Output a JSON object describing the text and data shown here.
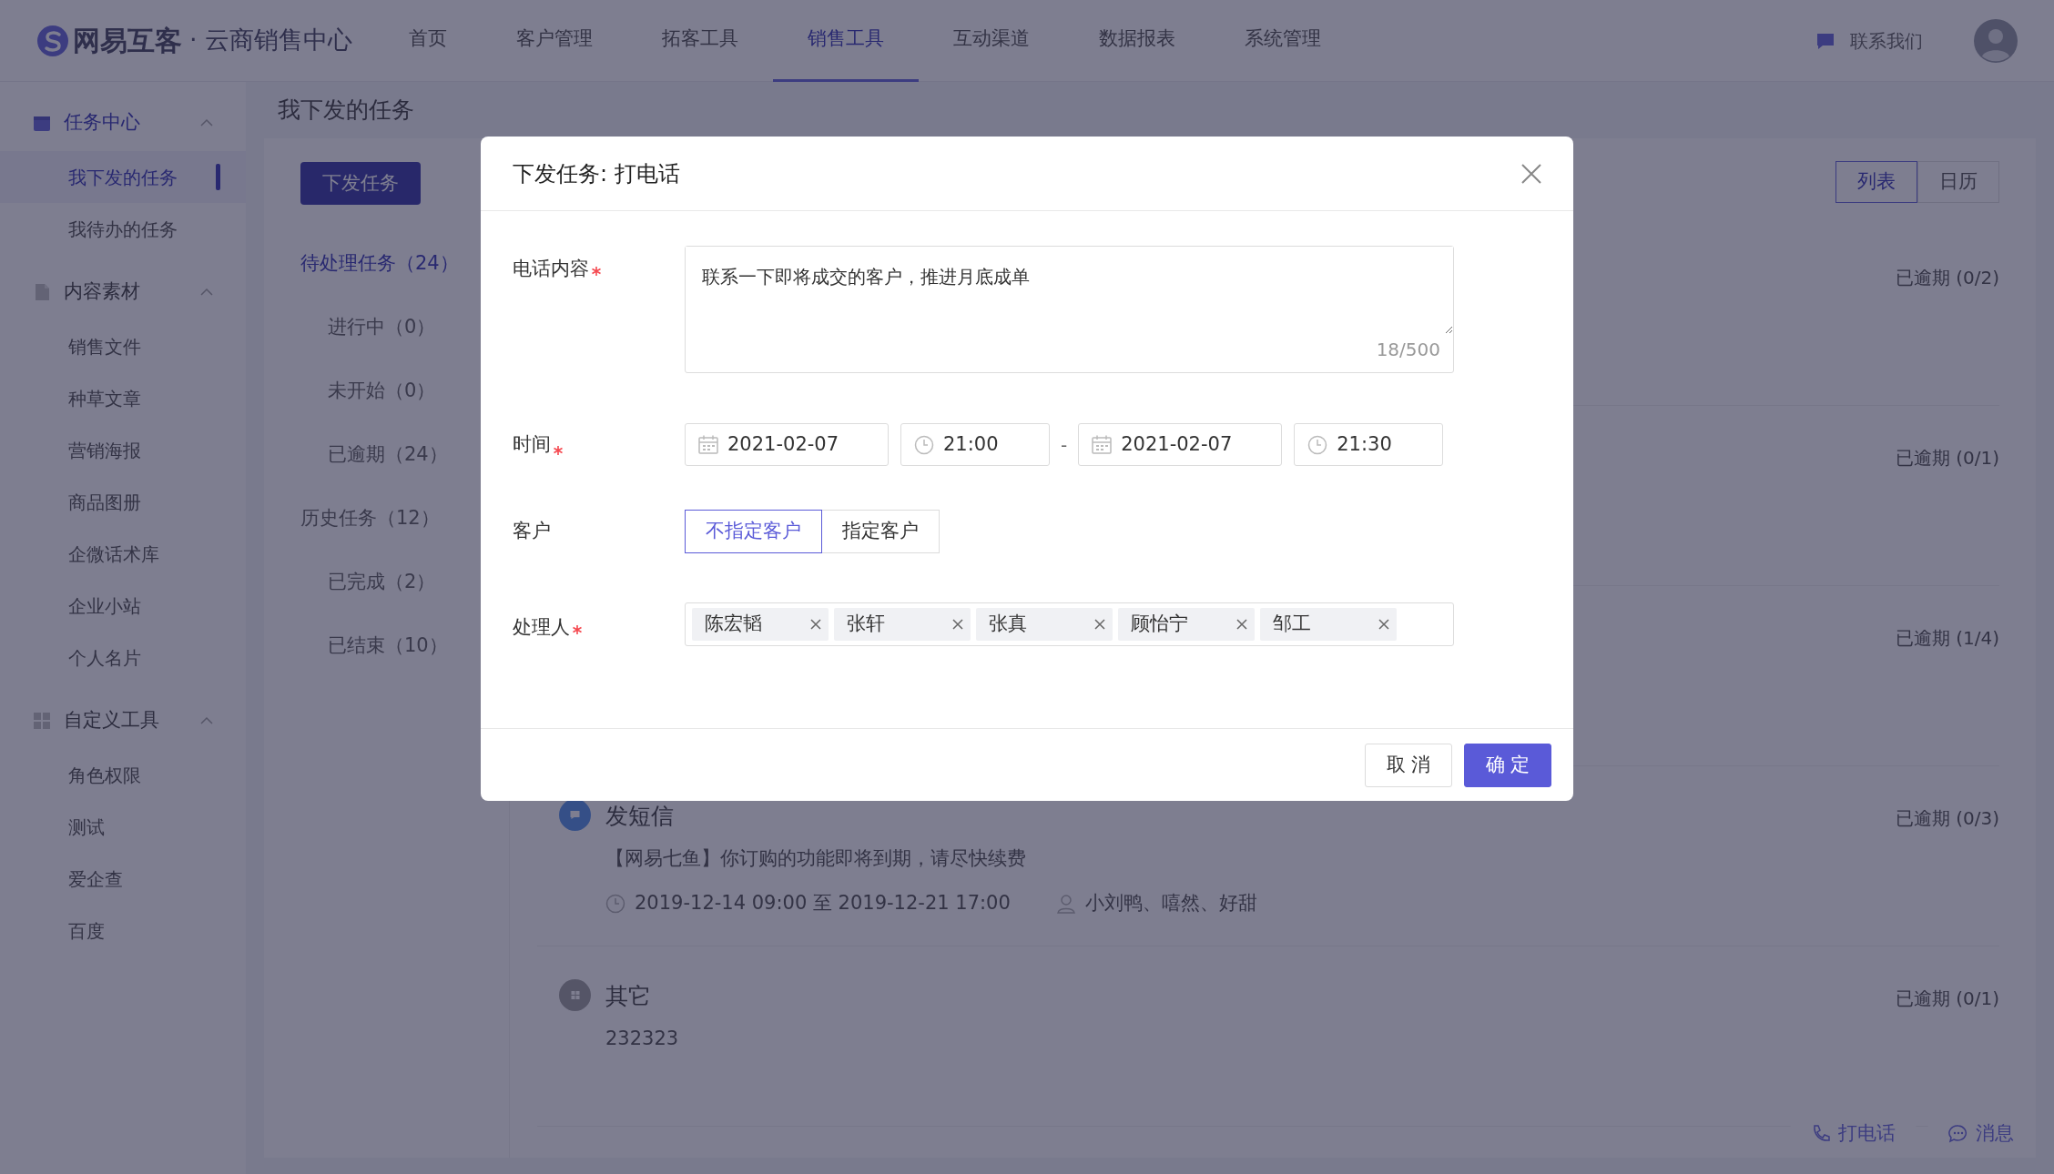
{
  "top_nav": {
    "brand": "网易互客",
    "separator": "·",
    "subtitle": "云商销售中心",
    "items": [
      {
        "label": "首页",
        "selected": false
      },
      {
        "label": "客户管理",
        "selected": false
      },
      {
        "label": "拓客工具",
        "selected": false
      },
      {
        "label": "销售工具",
        "selected": true
      },
      {
        "label": "互动渠道",
        "selected": false
      },
      {
        "label": "数据报表",
        "selected": false
      },
      {
        "label": "系统管理",
        "selected": false
      }
    ],
    "contact": "联系我们"
  },
  "sidebar": {
    "groups": [
      {
        "title": "任务中心",
        "expanded": true,
        "items": [
          {
            "label": "我下发的任务",
            "selected": true
          },
          {
            "label": "我待办的任务",
            "selected": false
          }
        ]
      },
      {
        "title": "内容素材",
        "expanded": true,
        "items": [
          {
            "label": "销售文件",
            "selected": false
          },
          {
            "label": "种草文章",
            "selected": false
          },
          {
            "label": "营销海报",
            "selected": false
          },
          {
            "label": "商品图册",
            "selected": false
          },
          {
            "label": "企微话术库",
            "selected": false
          },
          {
            "label": "企业小站",
            "selected": false
          },
          {
            "label": "个人名片",
            "selected": false
          }
        ]
      },
      {
        "title": "自定义工具",
        "expanded": true,
        "items": [
          {
            "label": "角色权限",
            "selected": false
          },
          {
            "label": "测试",
            "selected": false
          },
          {
            "label": "爱企查",
            "selected": false
          },
          {
            "label": "百度",
            "selected": false
          }
        ]
      }
    ]
  },
  "page_title": "我下发的任务",
  "task_panel": {
    "new_task_button": "下发任务",
    "filters": [
      {
        "label": "待处理任务（24）",
        "selected": true,
        "children": [
          {
            "label": "进行中（0）",
            "selected": false
          },
          {
            "label": "未开始（0）",
            "selected": false
          },
          {
            "label": "已逾期（24）",
            "selected": false
          }
        ]
      },
      {
        "label": "历史任务（12）",
        "selected": false,
        "children": [
          {
            "label": "已完成（2）",
            "selected": false
          },
          {
            "label": "已结束（10）",
            "selected": false
          }
        ]
      }
    ]
  },
  "view_toggle": [
    {
      "label": "列表",
      "selected": true
    },
    {
      "label": "日历",
      "selected": false
    }
  ],
  "tasks": [
    {
      "status": "已逾期 (0/2)"
    },
    {
      "status": "已逾期 (0/1)"
    },
    {
      "status": "已逾期 (1/4)"
    },
    {
      "kind": "sms",
      "title": "发短信",
      "content": "【网易七鱼】你订购的功能即将到期，请尽快续费",
      "time": "2019-12-14 09:00 至 2019-12-21 17:00",
      "assignees": "小刘鸭、嘻然、好甜",
      "status": "已逾期 (0/3)"
    },
    {
      "kind": "other",
      "title": "其它",
      "content": "232323",
      "status": "已逾期 (0/1)"
    }
  ],
  "floating_actions": [
    {
      "kind": "phone",
      "label": "打电话"
    },
    {
      "kind": "message",
      "label": "消息"
    }
  ],
  "dialog": {
    "title": "下发任务: 打电话",
    "fields": [
      {
        "kind": "textarea",
        "label": "电话内容",
        "required": true,
        "value": "联系一下即将成交的客户，推进月底成单",
        "counter": "18/500"
      },
      {
        "kind": "datetime_range",
        "label": "时间",
        "required": true,
        "start_date": "2021-02-07",
        "start_time": "21:00",
        "separator": "-",
        "end_date": "2021-02-07",
        "end_time": "21:30"
      },
      {
        "kind": "segmented",
        "label": "客户",
        "required": false,
        "options": [
          {
            "label": "不指定客户",
            "selected": true
          },
          {
            "label": "指定客户",
            "selected": false
          }
        ]
      },
      {
        "kind": "tags",
        "label": "处理人",
        "required": true,
        "tags": [
          "陈宏韬",
          "张轩",
          "张真",
          "顾怡宁",
          "邹工"
        ]
      }
    ],
    "buttons": [
      {
        "kind": "secondary",
        "label": "取 消"
      },
      {
        "kind": "primary",
        "label": "确 定"
      }
    ]
  }
}
